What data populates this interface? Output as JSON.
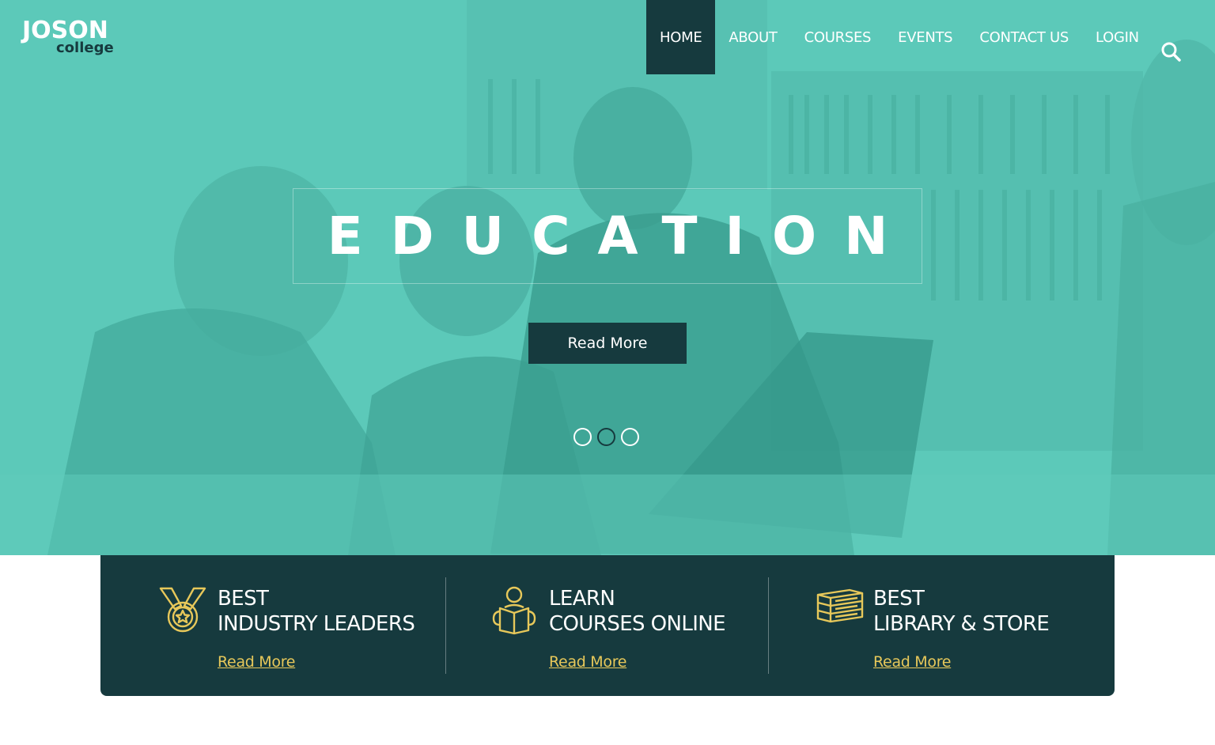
{
  "logo": {
    "line1": "JOSON",
    "line2": "college"
  },
  "nav": {
    "items": [
      {
        "label": "HOME",
        "active": true
      },
      {
        "label": "ABOUT",
        "active": false
      },
      {
        "label": "COURSES",
        "active": false
      },
      {
        "label": "EVENTS",
        "active": false
      },
      {
        "label": "CONTACT US",
        "active": false
      },
      {
        "label": "LOGIN",
        "active": false
      }
    ],
    "search_icon": "search-icon"
  },
  "hero": {
    "title": "EDUCATION",
    "cta_label": "Read More",
    "slides": 3,
    "active_slide": 2
  },
  "features": [
    {
      "icon": "medal-icon",
      "line1": "BEST",
      "line2": "INDUSTRY LEADERS",
      "link": "Read More"
    },
    {
      "icon": "reader-icon",
      "line1": "LEARN",
      "line2": "COURSES ONLINE",
      "link": "Read More"
    },
    {
      "icon": "books-icon",
      "line1": "BEST",
      "line2": "LIBRARY & STORE",
      "link": "Read More"
    }
  ],
  "colors": {
    "teal_overlay": "#5bc8b8",
    "dark_teal": "#163a3e",
    "gold_accent": "#e7c85a",
    "white": "#ffffff"
  }
}
